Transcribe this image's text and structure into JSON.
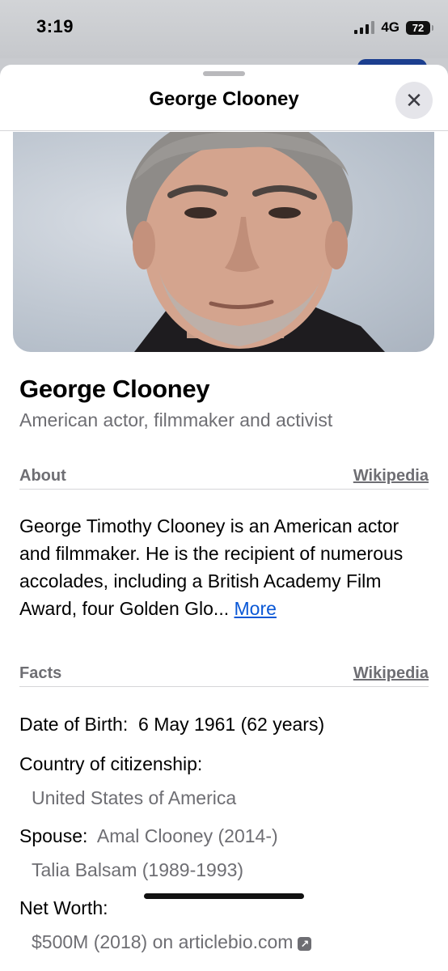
{
  "status_bar": {
    "time": "3:19",
    "network": "4G",
    "battery": "72"
  },
  "sheet": {
    "title": "George Clooney",
    "close_icon": "close-icon"
  },
  "person": {
    "name": "George Clooney",
    "description": "American actor, filmmaker and activist"
  },
  "about": {
    "label": "About",
    "source": "Wikipedia",
    "text": "George Timothy Clooney is an American actor and filmmaker. He is the recipient of numerous accolades, including a British Academy Film Award, four Golden Glo...",
    "more_label": "More"
  },
  "facts": {
    "label": "Facts",
    "source": "Wikipedia",
    "dob_label": "Date of Birth:",
    "dob_value": "6 May 1961 (62 years)",
    "citizenship_label": "Country of citizenship:",
    "citizenship_value": "United States of America",
    "spouse_label": "Spouse:",
    "spouse_1": "Amal Clooney (2014-)",
    "spouse_2": "Talia Balsam (1989-1993)",
    "net_worth_label": "Net Worth:",
    "net_worth_value": "$500M (2018) on articlebio.com",
    "external_icon": "external-link-icon"
  },
  "colors": {
    "link_blue": "#0a58d6",
    "secondary_gray": "#6e6e73",
    "divider": "#d6d6d9"
  }
}
